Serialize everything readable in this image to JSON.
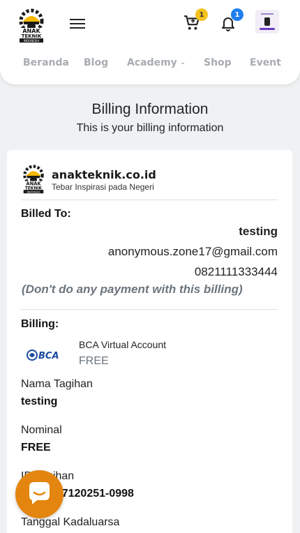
{
  "header": {
    "cart_count": "1",
    "notification_count": "1"
  },
  "nav": {
    "items": [
      "Beranda",
      "Blog",
      "Academy",
      "Shop",
      "Event"
    ],
    "academy_chevron": "⌄"
  },
  "page": {
    "title": "Billing Information",
    "subtitle": "This is your billing information"
  },
  "brand": {
    "name": "anakteknik.co.id",
    "tagline": "Tebar Inspirasi pada Negeri",
    "logo_text": [
      "ANAK",
      "TEKNIK",
      "INDONESIA"
    ]
  },
  "billed_to": {
    "label": "Billed To:",
    "name": "testing",
    "email": "anonymous.zone17@gmail.com",
    "phone": "0821111333444",
    "warning": "(Don't do any payment with this billing)"
  },
  "billing": {
    "label": "Billing:",
    "bank_logo": "BCA",
    "method": "BCA Virtual Account",
    "fee": "FREE",
    "nama_tagihan_label": "Nama Tagihan",
    "nama_tagihan_value": "testing",
    "nominal_label": "Nominal",
    "nominal_value": "FREE",
    "id_tagihan_label": "ID Tagihan",
    "id_tagihan_value": "229-2207120251-0998",
    "tanggal_label": "Tanggal Kadaluarsa"
  },
  "colors": {
    "accent_yellow": "#f5c21b",
    "accent_blue": "#1e7ff0",
    "chat_orange": "#e3850f",
    "nav_gray": "#a8acb1"
  }
}
